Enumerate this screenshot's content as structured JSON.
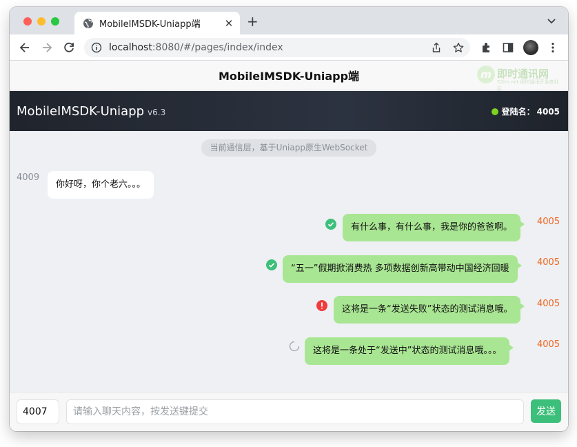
{
  "browser": {
    "tab_title": "MobileIMSDK-Uniapp端",
    "tab_close": "✕",
    "new_tab": "+",
    "url_host": "localhost",
    "url_rest": ":8080/#/pages/index/index"
  },
  "app": {
    "nav_title": "MobileIMSDK-Uniapp端",
    "watermark_text": "即时通讯网",
    "watermark_sub": "52im.net 即时通讯开发者社区",
    "watermark_letter": "m",
    "name": "MobileIMSDK-Uniapp",
    "version": "v6.3",
    "login_label": "登陆名：",
    "login_id": "4005",
    "online_color": "#7ed321"
  },
  "notice": "当前通信层，基于Uniapp原生WebSocket",
  "messages": [
    {
      "sender": "4009",
      "text": "你好呀，你个老六。。。",
      "direction": "in",
      "status": "none"
    },
    {
      "sender": "4005",
      "text": "有什么事，有什么事，我是你的爸爸啊。",
      "direction": "out",
      "status": "sent-check-icon"
    },
    {
      "sender": "4005",
      "text": "“五一”假期掀消费热 多项数据创新高带动中国经济回暖",
      "direction": "out",
      "status": "sent-check-icon"
    },
    {
      "sender": "4005",
      "text": "这将是一条“发送失败”状态的测试消息哦。",
      "direction": "out",
      "status": "failed-alert-icon"
    },
    {
      "sender": "4005",
      "text": "这将是一条处于“发送中”状态的测试消息哦。。。",
      "direction": "out",
      "status": "sending-spinner-icon"
    }
  ],
  "input": {
    "target_value": "4007",
    "placeholder": "请输入聊天内容，按发送键提交",
    "send_label": "发送"
  },
  "colors": {
    "bubble_out": "#a9e693",
    "send_button": "#3cbf7a",
    "sender_self": "#f0661f"
  }
}
